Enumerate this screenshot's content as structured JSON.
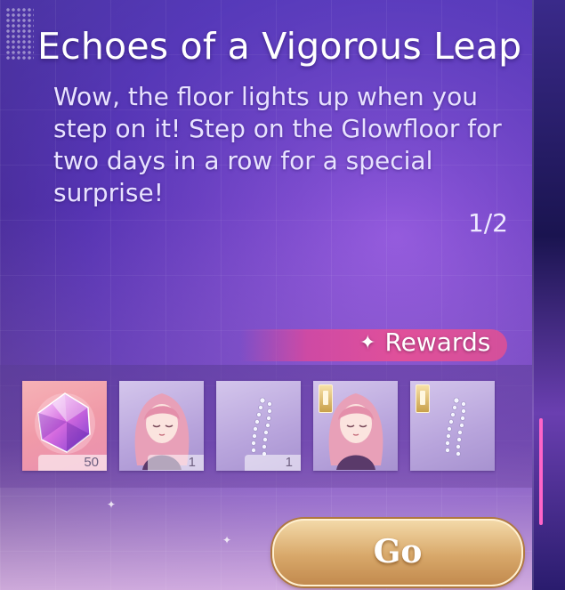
{
  "quest": {
    "title": "Echoes of a Vigorous Leap",
    "description": "Wow, the floor lights up when you step on it! Step on the Glowfloor for two days in a row for a special surprise!",
    "progress": "1/2"
  },
  "rewards": {
    "label": "Rewards",
    "items": [
      {
        "icon": "crystal-gem-icon",
        "count": "50"
      },
      {
        "icon": "pink-hair-girl-icon",
        "count": "1"
      },
      {
        "icon": "crystal-earring-icon",
        "count": "1"
      },
      {
        "icon": "pink-hair-girl-icon",
        "badge": "gold-tag-icon"
      },
      {
        "icon": "crystal-earring-icon",
        "badge": "gold-tag-icon"
      }
    ]
  },
  "actions": {
    "go_label": "Go"
  },
  "colors": {
    "banner": "#e0509a",
    "button_gold": "#d8a86a"
  }
}
